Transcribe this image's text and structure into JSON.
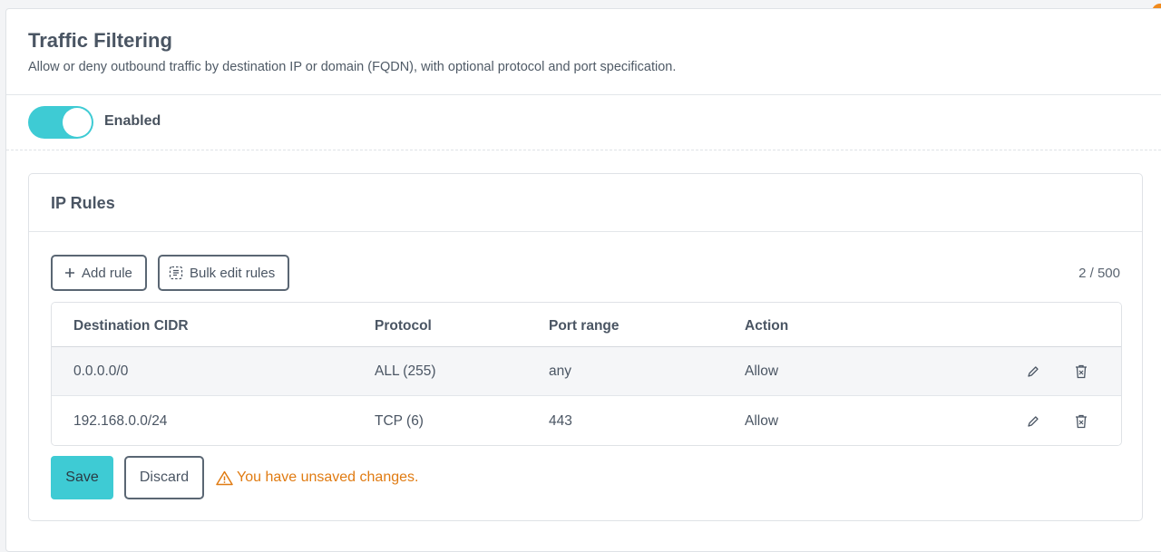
{
  "header": {
    "title": "Traffic Filtering",
    "subtitle": "Allow or deny outbound traffic by destination IP or domain (FQDN), with optional protocol and port specification."
  },
  "toggle": {
    "label": "Enabled",
    "state": "on",
    "color": "#3ecbd4"
  },
  "ip_rules": {
    "title": "IP Rules",
    "add_rule_label": "Add rule",
    "bulk_edit_label": "Bulk edit rules",
    "count": "2 / 500",
    "columns": [
      "Destination CIDR",
      "Protocol",
      "Port range",
      "Action"
    ],
    "rows": [
      {
        "cidr": "0.0.0.0/0",
        "protocol": "ALL (255)",
        "port": "any",
        "action": "Allow"
      },
      {
        "cidr": "192.168.0.0/24",
        "protocol": "TCP (6)",
        "port": "443",
        "action": "Allow"
      }
    ]
  },
  "footer": {
    "save_label": "Save",
    "discard_label": "Discard",
    "warning": "You have unsaved changes."
  },
  "colors": {
    "accent": "#3ecbd4",
    "warning": "#e07b12",
    "notification": "#f08a1c"
  },
  "icons": [
    "plus-icon",
    "bulk-edit-icon",
    "pencil-icon",
    "trash-icon",
    "warning-icon"
  ]
}
